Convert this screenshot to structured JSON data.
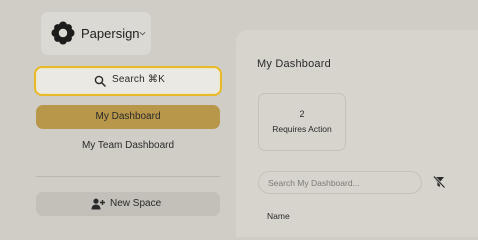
{
  "brand": {
    "name": "Papersign",
    "logo_icon": "flower-logo-icon",
    "dropdown_icon": "chevron-down-icon"
  },
  "search": {
    "label": "Search ⌘K",
    "icon": "search-icon"
  },
  "nav": {
    "items": [
      {
        "label": "My Dashboard",
        "active": true
      },
      {
        "label": "My Team Dashboard",
        "active": false
      }
    ]
  },
  "new_space": {
    "label": "New Space",
    "icon": "add-user-icon"
  },
  "main": {
    "title": "My Dashboard",
    "stat": {
      "count": "2",
      "label": "Requires Action"
    },
    "search_placeholder": "Search My Dashboard...",
    "filter_icon": "filter-clear-icon",
    "columns": [
      "Name"
    ]
  },
  "colors": {
    "accent": "#e8b928",
    "active_nav": "#b8974a"
  }
}
